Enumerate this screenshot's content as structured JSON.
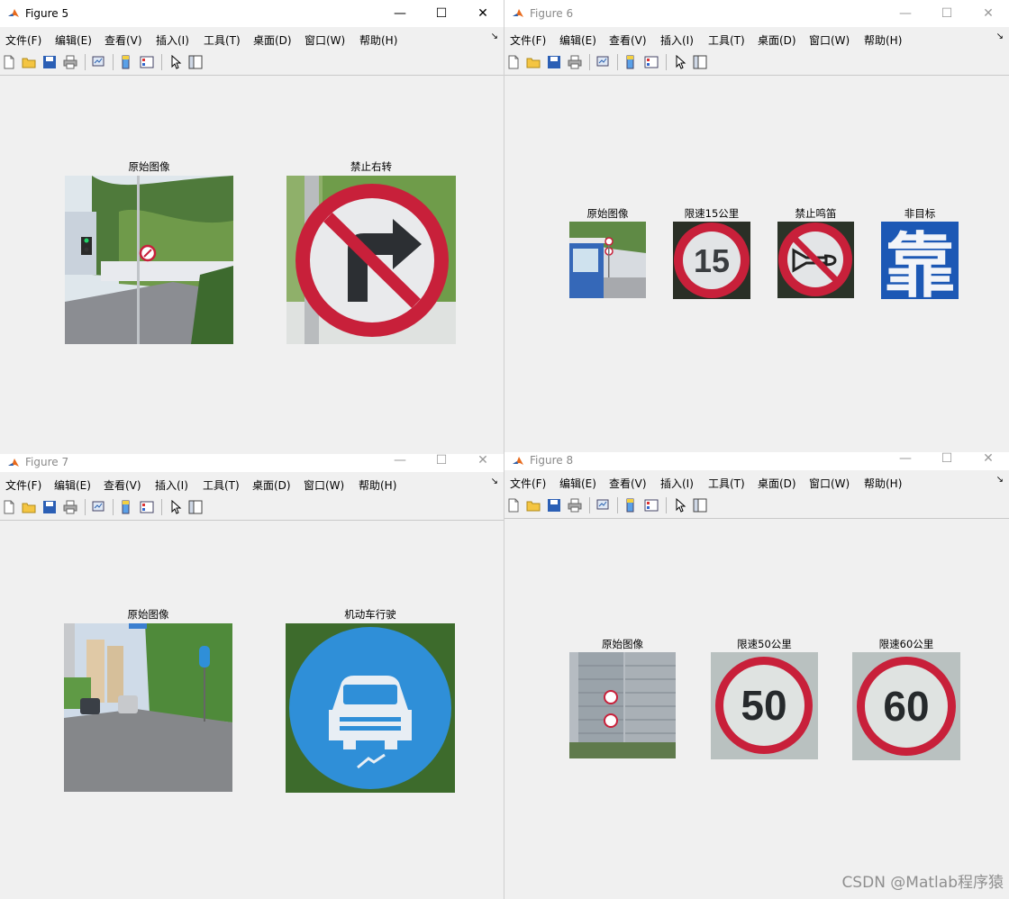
{
  "menu": {
    "file": "文件(F)",
    "edit": "编辑(E)",
    "view": "查看(V)",
    "insert": "插入(I)",
    "tools": "工具(T)",
    "desktop": "桌面(D)",
    "window": "窗口(W)",
    "help": "帮助(H)",
    "more": "↘"
  },
  "window_controls": {
    "minimize": "—",
    "maximize": "☐",
    "close": "✕"
  },
  "toolbar_icons": [
    "new-figure-icon",
    "open-file-icon",
    "save-icon",
    "print-icon",
    "link-plot-icon",
    "insert-colorbar-icon",
    "insert-legend-icon",
    "edit-plot-arrow-icon",
    "property-inspector-icon"
  ],
  "figures": {
    "fig5": {
      "title": "Figure 5",
      "active": true,
      "images": [
        {
          "label": "原始图像"
        },
        {
          "label": "禁止右转"
        }
      ]
    },
    "fig6": {
      "title": "Figure 6",
      "active": false,
      "images": [
        {
          "label": "原始图像"
        },
        {
          "label": "限速15公里"
        },
        {
          "label": "禁止鸣笛"
        },
        {
          "label": "非目标"
        }
      ]
    },
    "fig7": {
      "title": "Figure 7",
      "active": false,
      "images": [
        {
          "label": "原始图像"
        },
        {
          "label": "机动车行驶"
        }
      ]
    },
    "fig8": {
      "title": "Figure 8",
      "active": false,
      "images": [
        {
          "label": "原始图像"
        },
        {
          "label": "限速50公里"
        },
        {
          "label": "限速60公里"
        }
      ]
    }
  },
  "sign_text": {
    "speed15": "15",
    "speed50": "50",
    "speed60": "60",
    "kao": "靠"
  },
  "watermark": "CSDN @Matlab程序猿",
  "colors": {
    "sign_red": "#c8203a",
    "sign_blue": "#2f8fd8",
    "matlab_orange": "#e86a1c"
  }
}
